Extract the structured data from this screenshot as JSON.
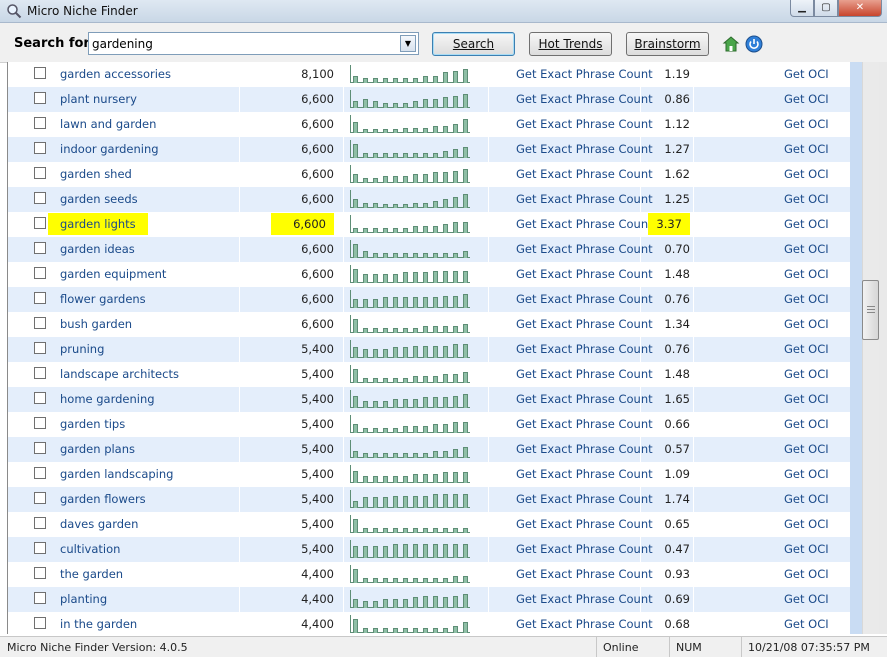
{
  "window": {
    "title": "Micro Niche Finder"
  },
  "toolbar": {
    "search_label": "Search for:",
    "search_value": "gardening",
    "search_button": "Search",
    "hot_trends_button": "Hot Trends",
    "brainstorm_button": "Brainstorm",
    "home_icon": "home-icon",
    "power_icon": "power-icon"
  },
  "rows": [
    {
      "keyword": "garden accessories",
      "count": "8,100",
      "link": "Get Exact Phrase Count",
      "ratio": "1.19",
      "oci": "Get OCI",
      "highlight": false,
      "trend": [
        4,
        3,
        3,
        3,
        3,
        3,
        3,
        4,
        4,
        6,
        7,
        8
      ]
    },
    {
      "keyword": "plant nursery",
      "count": "6,600",
      "link": "Get Exact Phrase Count",
      "ratio": "0.86",
      "oci": "Get OCI",
      "highlight": false,
      "trend": [
        4,
        5,
        4,
        3,
        3,
        3,
        4,
        5,
        5,
        6,
        7,
        8
      ]
    },
    {
      "keyword": "lawn and garden",
      "count": "6,600",
      "link": "Get Exact Phrase Count",
      "ratio": "1.12",
      "oci": "Get OCI",
      "highlight": false,
      "trend": [
        6,
        2,
        2,
        2,
        2,
        3,
        3,
        3,
        4,
        4,
        5,
        8
      ]
    },
    {
      "keyword": "indoor gardening",
      "count": "6,600",
      "link": "Get Exact Phrase Count",
      "ratio": "1.27",
      "oci": "Get OCI",
      "highlight": false,
      "trend": [
        8,
        3,
        3,
        3,
        3,
        3,
        3,
        3,
        3,
        4,
        5,
        6
      ]
    },
    {
      "keyword": "garden shed",
      "count": "6,600",
      "link": "Get Exact Phrase Count",
      "ratio": "1.62",
      "oci": "Get OCI",
      "highlight": false,
      "trend": [
        5,
        3,
        3,
        4,
        4,
        4,
        5,
        5,
        6,
        6,
        7,
        8
      ]
    },
    {
      "keyword": "garden seeds",
      "count": "6,600",
      "link": "Get Exact Phrase Count",
      "ratio": "1.25",
      "oci": "Get OCI",
      "highlight": false,
      "trend": [
        5,
        3,
        3,
        2,
        2,
        2,
        3,
        3,
        4,
        5,
        6,
        8
      ]
    },
    {
      "keyword": "garden lights",
      "count": "6,600",
      "link": "Get Exact Phrase Count",
      "ratio": "3.37",
      "oci": "Get OCI",
      "highlight": true,
      "trend": [
        3,
        3,
        3,
        3,
        3,
        3,
        4,
        4,
        4,
        5,
        6,
        6
      ]
    },
    {
      "keyword": "garden ideas",
      "count": "6,600",
      "link": "Get Exact Phrase Count",
      "ratio": "0.70",
      "oci": "Get OCI",
      "highlight": false,
      "trend": [
        8,
        4,
        3,
        3,
        3,
        3,
        3,
        3,
        3,
        3,
        3,
        4
      ]
    },
    {
      "keyword": "garden equipment",
      "count": "6,600",
      "link": "Get Exact Phrase Count",
      "ratio": "1.48",
      "oci": "Get OCI",
      "highlight": false,
      "trend": [
        8,
        5,
        5,
        5,
        5,
        6,
        6,
        6,
        7,
        7,
        7,
        7
      ]
    },
    {
      "keyword": "flower gardens",
      "count": "6,600",
      "link": "Get Exact Phrase Count",
      "ratio": "0.76",
      "oci": "Get OCI",
      "highlight": false,
      "trend": [
        5,
        5,
        5,
        6,
        6,
        6,
        6,
        6,
        6,
        7,
        7,
        8
      ]
    },
    {
      "keyword": "bush garden",
      "count": "6,600",
      "link": "Get Exact Phrase Count",
      "ratio": "1.34",
      "oci": "Get OCI",
      "highlight": false,
      "trend": [
        8,
        3,
        3,
        3,
        3,
        3,
        3,
        4,
        4,
        4,
        4,
        5
      ]
    },
    {
      "keyword": "pruning",
      "count": "5,400",
      "link": "Get Exact Phrase Count",
      "ratio": "0.76",
      "oci": "Get OCI",
      "highlight": false,
      "trend": [
        6,
        5,
        5,
        5,
        6,
        6,
        7,
        7,
        7,
        7,
        8,
        8
      ]
    },
    {
      "keyword": "landscape architects",
      "count": "5,400",
      "link": "Get Exact Phrase Count",
      "ratio": "1.48",
      "oci": "Get OCI",
      "highlight": false,
      "trend": [
        8,
        3,
        3,
        3,
        3,
        3,
        4,
        4,
        4,
        5,
        5,
        6
      ]
    },
    {
      "keyword": "home gardening",
      "count": "5,400",
      "link": "Get Exact Phrase Count",
      "ratio": "1.65",
      "oci": "Get OCI",
      "highlight": false,
      "trend": [
        7,
        4,
        4,
        4,
        5,
        5,
        5,
        6,
        6,
        6,
        7,
        8
      ]
    },
    {
      "keyword": "garden tips",
      "count": "5,400",
      "link": "Get Exact Phrase Count",
      "ratio": "0.66",
      "oci": "Get OCI",
      "highlight": false,
      "trend": [
        5,
        3,
        3,
        3,
        3,
        4,
        4,
        4,
        5,
        5,
        6,
        6
      ]
    },
    {
      "keyword": "garden plans",
      "count": "5,400",
      "link": "Get Exact Phrase Count",
      "ratio": "0.57",
      "oci": "Get OCI",
      "highlight": false,
      "trend": [
        4,
        3,
        3,
        3,
        3,
        3,
        3,
        3,
        4,
        4,
        5,
        6
      ]
    },
    {
      "keyword": "garden landscaping",
      "count": "5,400",
      "link": "Get Exact Phrase Count",
      "ratio": "1.09",
      "oci": "Get OCI",
      "highlight": false,
      "trend": [
        7,
        4,
        4,
        4,
        4,
        4,
        5,
        5,
        5,
        6,
        6,
        6
      ]
    },
    {
      "keyword": "garden flowers",
      "count": "5,400",
      "link": "Get Exact Phrase Count",
      "ratio": "1.74",
      "oci": "Get OCI",
      "highlight": false,
      "trend": [
        4,
        6,
        6,
        6,
        7,
        7,
        7,
        7,
        8,
        8,
        8,
        8
      ]
    },
    {
      "keyword": "daves garden",
      "count": "5,400",
      "link": "Get Exact Phrase Count",
      "ratio": "0.65",
      "oci": "Get OCI",
      "highlight": false,
      "trend": [
        8,
        3,
        3,
        3,
        3,
        3,
        3,
        3,
        3,
        3,
        3,
        3
      ]
    },
    {
      "keyword": "cultivation",
      "count": "5,400",
      "link": "Get Exact Phrase Count",
      "ratio": "0.47",
      "oci": "Get OCI",
      "highlight": false,
      "trend": [
        7,
        7,
        7,
        7,
        8,
        8,
        8,
        8,
        8,
        8,
        8,
        8
      ]
    },
    {
      "keyword": "the garden",
      "count": "4,400",
      "link": "Get Exact Phrase Count",
      "ratio": "0.93",
      "oci": "Get OCI",
      "highlight": false,
      "trend": [
        8,
        3,
        3,
        3,
        3,
        3,
        3,
        3,
        3,
        3,
        4,
        4
      ]
    },
    {
      "keyword": "planting",
      "count": "4,400",
      "link": "Get Exact Phrase Count",
      "ratio": "0.69",
      "oci": "Get OCI",
      "highlight": false,
      "trend": [
        5,
        4,
        4,
        5,
        5,
        5,
        6,
        7,
        7,
        6,
        7,
        8
      ]
    },
    {
      "keyword": "in the garden",
      "count": "4,400",
      "link": "Get Exact Phrase Count",
      "ratio": "0.68",
      "oci": "Get OCI",
      "highlight": false,
      "trend": [
        8,
        3,
        3,
        3,
        3,
        3,
        3,
        3,
        3,
        3,
        4,
        6
      ]
    }
  ],
  "colors": {
    "highlight": "#ffff00",
    "link": "#1a4a8a",
    "alt_row": "#e4eefb",
    "trend_bar": "#8fbfa6"
  },
  "statusbar": {
    "version": "Micro Niche Finder Version: 4.0.5",
    "online": "Online",
    "num": "NUM",
    "datetime": "10/21/08 07:35:57 PM"
  }
}
